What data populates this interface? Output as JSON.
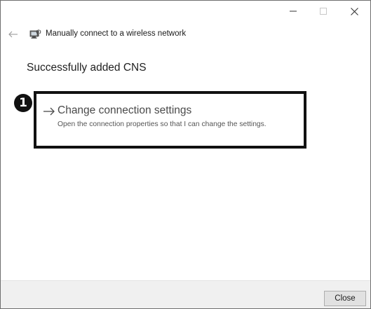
{
  "window": {
    "header_title": "Manually connect to a wireless network",
    "buttons": {
      "minimize_icon": "minimize-icon",
      "maximize_icon": "maximize-icon",
      "close_icon": "close-icon"
    }
  },
  "main": {
    "heading": "Successfully added CNS",
    "callout_number": "1",
    "option": {
      "title": "Change connection settings",
      "description": "Open the connection properties so that I can change the settings.",
      "icon": "arrow-right-icon"
    }
  },
  "footer": {
    "close_label": "Close"
  },
  "colors": {
    "callout_border": "#111111",
    "footer_bg": "#f0f0f0",
    "option_text": "#4a4a4a"
  }
}
